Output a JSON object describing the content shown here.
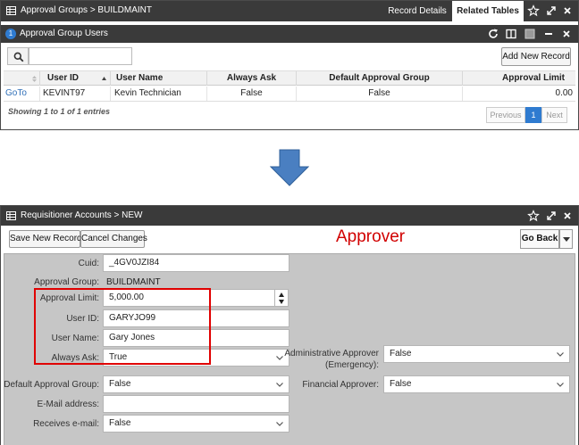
{
  "top_panel": {
    "title": "Approval Groups > BUILDMAINT",
    "tabs": [
      "Record Details",
      "Related Tables"
    ],
    "active_tab": "Related Tables",
    "section": {
      "badge": "1",
      "title": "Approval Group Users"
    },
    "search": {
      "placeholder": "",
      "value": ""
    },
    "add_button": "Add New Record",
    "table": {
      "columns": [
        "User ID",
        "User Name",
        "Always Ask",
        "Default Approval Group",
        "Approval Limit"
      ],
      "rows": [
        {
          "action": "GoTo",
          "user_id": "KEVINT97",
          "user_name": "Kevin Technician",
          "always_ask": "False",
          "default_group": "False",
          "limit": "0.00"
        }
      ]
    },
    "showing": "Showing 1 to 1 of 1 entries",
    "pagination": {
      "previous": "Previous",
      "current": "1",
      "next": "Next"
    }
  },
  "bottom_panel": {
    "title": "Requisitioner Accounts > NEW",
    "buttons": {
      "save_new": "Save New Record",
      "cancel": "Cancel Changes",
      "go_back": "Go Back"
    },
    "annotation": "Approver",
    "form": {
      "cuid": {
        "label": "Cuid:",
        "value": "_4GV0JZI84"
      },
      "approval_group": {
        "label": "Approval Group:",
        "value": "BUILDMAINT"
      },
      "approval_limit": {
        "label": "Approval Limit:",
        "value": "5,000.00"
      },
      "user_id": {
        "label": "User ID:",
        "value": "GARYJO99"
      },
      "user_name": {
        "label": "User Name:",
        "value": "Gary Jones"
      },
      "always_ask": {
        "label": "Always Ask:",
        "value": "True"
      },
      "admin_approver": {
        "label_line1": "Administrative Approver",
        "label_line2": "(Emergency):",
        "value": "False"
      },
      "default_approval_group": {
        "label": "Default Approval Group:",
        "value": "False"
      },
      "financial_approver": {
        "label": "Financial Approver:",
        "value": "False"
      },
      "email": {
        "label": "E-Mail address:",
        "value": ""
      },
      "receives_email": {
        "label": "Receives e-mail:",
        "value": "False"
      }
    }
  },
  "colors": {
    "titlebar": "#3a3a3a",
    "accent": "#2f7bd0",
    "annotation": "#d10000",
    "form_bg": "#c6c6c6",
    "arrow": "#4a7fc1"
  },
  "icons": [
    "grid-icon",
    "star-icon",
    "expand-icon",
    "close-icon",
    "refresh-icon",
    "columns-icon",
    "square-icon",
    "minimize-icon",
    "search-icon",
    "chevron-down-icon",
    "down-arrow-icon"
  ]
}
